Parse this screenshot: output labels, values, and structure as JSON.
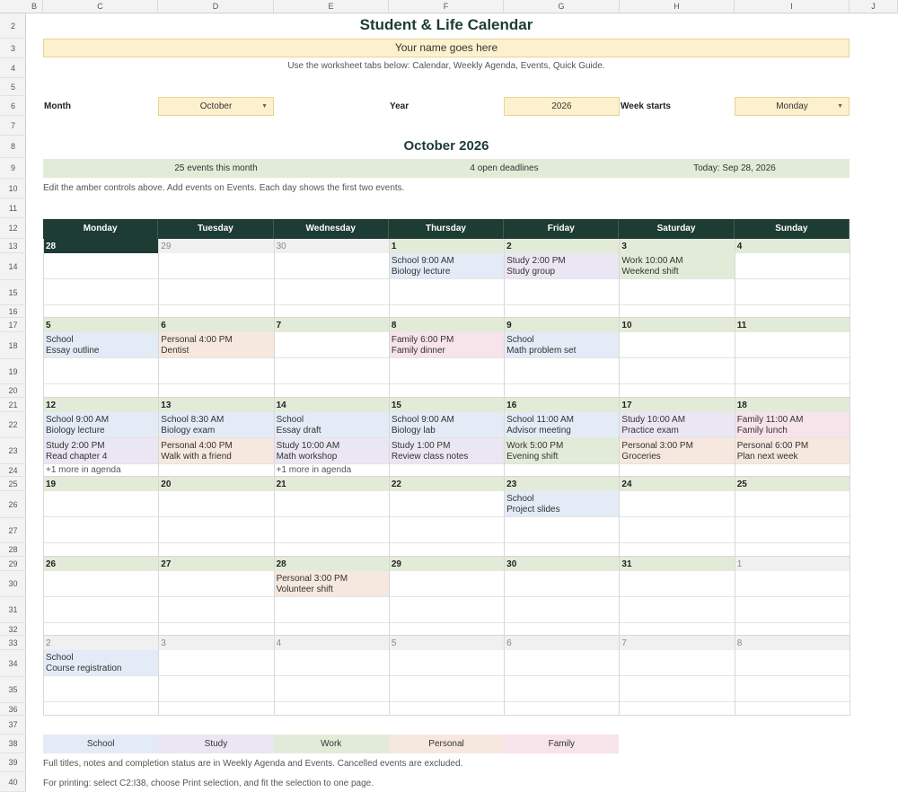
{
  "spreadsheet": {
    "columns": [
      "B",
      "C",
      "D",
      "E",
      "F",
      "G",
      "H",
      "I",
      "J"
    ],
    "rows": [
      "2",
      "3",
      "4",
      "5",
      "6",
      "7",
      "8",
      "9",
      "10",
      "11",
      "12",
      "13",
      "14",
      "15",
      "16",
      "17",
      "18",
      "19",
      "20",
      "21",
      "22",
      "23",
      "24",
      "25",
      "26",
      "27",
      "28",
      "29",
      "30",
      "31",
      "32",
      "33",
      "34",
      "35",
      "36",
      "37",
      "38",
      "39",
      "40"
    ]
  },
  "header": {
    "title": "Student & Life Calendar",
    "name_placeholder": "Your name goes here",
    "instructions": "Use the worksheet tabs below: Calendar, Weekly Agenda, Events, Quick Guide."
  },
  "controls": {
    "month_label": "Month",
    "month_value": "October",
    "year_label": "Year",
    "year_value": "2026",
    "week_starts_label": "Week starts",
    "week_starts_value": "Monday"
  },
  "month_title": "October 2026",
  "summary": {
    "events": "25 events this month",
    "deadlines": "4 open deadlines",
    "today": "Today: Sep 28, 2026"
  },
  "help_text": "Edit the amber controls above. Add events on Events. Each day shows the first two events.",
  "weekdays": [
    "Monday",
    "Tuesday",
    "Wednesday",
    "Thursday",
    "Friday",
    "Saturday",
    "Sunday"
  ],
  "colors": {
    "School": "#e3ebf6",
    "Study": "#ebe6f3",
    "Work": "#e2ebd8",
    "Personal": "#f6e8de",
    "Family": "#f7e3ea",
    "header_dark": "#1d3c34",
    "amber": "#fdf1cd"
  },
  "weeks": [
    {
      "days": [
        {
          "num": "28",
          "state": "today",
          "events": []
        },
        {
          "num": "29",
          "state": "other",
          "events": []
        },
        {
          "num": "30",
          "state": "other",
          "events": []
        },
        {
          "num": "1",
          "state": "cur",
          "events": [
            {
              "cat": "School",
              "line1": "School 9:00 AM",
              "line2": "Biology lecture"
            }
          ]
        },
        {
          "num": "2",
          "state": "cur",
          "events": [
            {
              "cat": "Study",
              "line1": "Study 2:00 PM",
              "line2": "Study group"
            }
          ]
        },
        {
          "num": "3",
          "state": "cur",
          "events": [
            {
              "cat": "Work",
              "line1": "Work 10:00 AM",
              "line2": "Weekend shift"
            }
          ]
        },
        {
          "num": "4",
          "state": "cur",
          "events": []
        }
      ]
    },
    {
      "days": [
        {
          "num": "5",
          "state": "cur",
          "events": [
            {
              "cat": "School",
              "line1": "School",
              "line2": "Essay outline"
            }
          ]
        },
        {
          "num": "6",
          "state": "cur",
          "events": [
            {
              "cat": "Personal",
              "line1": "Personal 4:00 PM",
              "line2": "Dentist"
            }
          ]
        },
        {
          "num": "7",
          "state": "cur",
          "events": []
        },
        {
          "num": "8",
          "state": "cur",
          "events": [
            {
              "cat": "Family",
              "line1": "Family 6:00 PM",
              "line2": "Family dinner"
            }
          ]
        },
        {
          "num": "9",
          "state": "cur",
          "events": [
            {
              "cat": "School",
              "line1": "School",
              "line2": "Math problem set"
            }
          ]
        },
        {
          "num": "10",
          "state": "cur",
          "events": []
        },
        {
          "num": "11",
          "state": "cur",
          "events": []
        }
      ]
    },
    {
      "days": [
        {
          "num": "12",
          "state": "cur",
          "more": "+1 more in agenda",
          "events": [
            {
              "cat": "School",
              "line1": "School 9:00 AM",
              "line2": "Biology lecture"
            },
            {
              "cat": "Study",
              "line1": "Study 2:00 PM",
              "line2": "Read chapter 4"
            }
          ]
        },
        {
          "num": "13",
          "state": "cur",
          "events": [
            {
              "cat": "School",
              "line1": "School 8:30 AM",
              "line2": "Biology exam"
            },
            {
              "cat": "Personal",
              "line1": "Personal 4:00 PM",
              "line2": "Walk with a friend"
            }
          ]
        },
        {
          "num": "14",
          "state": "cur",
          "more": "+1 more in agenda",
          "events": [
            {
              "cat": "School",
              "line1": "School",
              "line2": "Essay draft"
            },
            {
              "cat": "Study",
              "line1": "Study 10:00 AM",
              "line2": "Math workshop"
            }
          ]
        },
        {
          "num": "15",
          "state": "cur",
          "events": [
            {
              "cat": "School",
              "line1": "School 9:00 AM",
              "line2": "Biology lab"
            },
            {
              "cat": "Study",
              "line1": "Study 1:00 PM",
              "line2": "Review class notes"
            }
          ]
        },
        {
          "num": "16",
          "state": "cur",
          "events": [
            {
              "cat": "School",
              "line1": "School 11:00 AM",
              "line2": "Advisor meeting"
            },
            {
              "cat": "Work",
              "line1": "Work 5:00 PM",
              "line2": "Evening shift"
            }
          ]
        },
        {
          "num": "17",
          "state": "cur",
          "events": [
            {
              "cat": "Study",
              "line1": "Study 10:00 AM",
              "line2": "Practice exam"
            },
            {
              "cat": "Personal",
              "line1": "Personal 3:00 PM",
              "line2": "Groceries"
            }
          ]
        },
        {
          "num": "18",
          "state": "cur",
          "events": [
            {
              "cat": "Family",
              "line1": "Family 11:00 AM",
              "line2": "Family lunch"
            },
            {
              "cat": "Personal",
              "line1": "Personal 6:00 PM",
              "line2": "Plan next week"
            }
          ]
        }
      ]
    },
    {
      "days": [
        {
          "num": "19",
          "state": "cur",
          "events": []
        },
        {
          "num": "20",
          "state": "cur",
          "events": []
        },
        {
          "num": "21",
          "state": "cur",
          "events": []
        },
        {
          "num": "22",
          "state": "cur",
          "events": []
        },
        {
          "num": "23",
          "state": "cur",
          "events": [
            {
              "cat": "School",
              "line1": "School",
              "line2": "Project slides"
            }
          ]
        },
        {
          "num": "24",
          "state": "cur",
          "events": []
        },
        {
          "num": "25",
          "state": "cur",
          "events": []
        }
      ]
    },
    {
      "days": [
        {
          "num": "26",
          "state": "cur",
          "events": []
        },
        {
          "num": "27",
          "state": "cur",
          "events": []
        },
        {
          "num": "28",
          "state": "cur",
          "events": [
            {
              "cat": "Personal",
              "line1": "Personal 3:00 PM",
              "line2": "Volunteer shift"
            }
          ]
        },
        {
          "num": "29",
          "state": "cur",
          "events": []
        },
        {
          "num": "30",
          "state": "cur",
          "events": []
        },
        {
          "num": "31",
          "state": "cur",
          "events": []
        },
        {
          "num": "1",
          "state": "other",
          "events": []
        }
      ]
    },
    {
      "days": [
        {
          "num": "2",
          "state": "other",
          "events": [
            {
              "cat": "School",
              "line1": "School",
              "line2": "Course registration"
            }
          ]
        },
        {
          "num": "3",
          "state": "other",
          "events": []
        },
        {
          "num": "4",
          "state": "other",
          "events": []
        },
        {
          "num": "5",
          "state": "other",
          "events": []
        },
        {
          "num": "6",
          "state": "other",
          "events": []
        },
        {
          "num": "7",
          "state": "other",
          "events": []
        },
        {
          "num": "8",
          "state": "other",
          "events": []
        }
      ]
    }
  ],
  "legend": [
    "School",
    "Study",
    "Work",
    "Personal",
    "Family"
  ],
  "footnotes": {
    "note1": "Full titles, notes and completion status are in Weekly Agenda and Events. Cancelled events are excluded.",
    "note2": "For printing: select C2:I38, choose Print selection, and fit the selection to one page."
  }
}
